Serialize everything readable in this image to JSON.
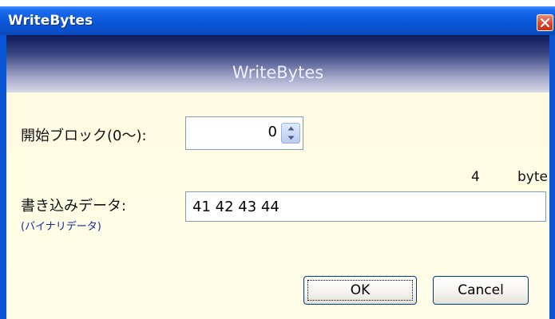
{
  "window": {
    "title": "WriteBytes",
    "banner_title": "WriteBytes"
  },
  "form": {
    "start_block_label": "開始ブロック(0～):",
    "start_block_value": "0",
    "byte_count": "4",
    "byte_unit": "byte",
    "write_data_label": "書き込みデータ:",
    "write_data_sublabel": "(バイナリデータ)",
    "write_data_value": "41 42 43 44"
  },
  "buttons": {
    "ok_label": "OK",
    "cancel_label": "Cancel"
  },
  "icons": {
    "close": "close-icon",
    "spin_up": "arrow-up-icon",
    "spin_down": "arrow-down-icon"
  },
  "colors": {
    "titlebar": "#0b57d8",
    "close_button": "#d9432a",
    "client_background": "#fffbe0",
    "banner_dark": "#0b1a5c",
    "sublabel": "#0a2aa0"
  }
}
